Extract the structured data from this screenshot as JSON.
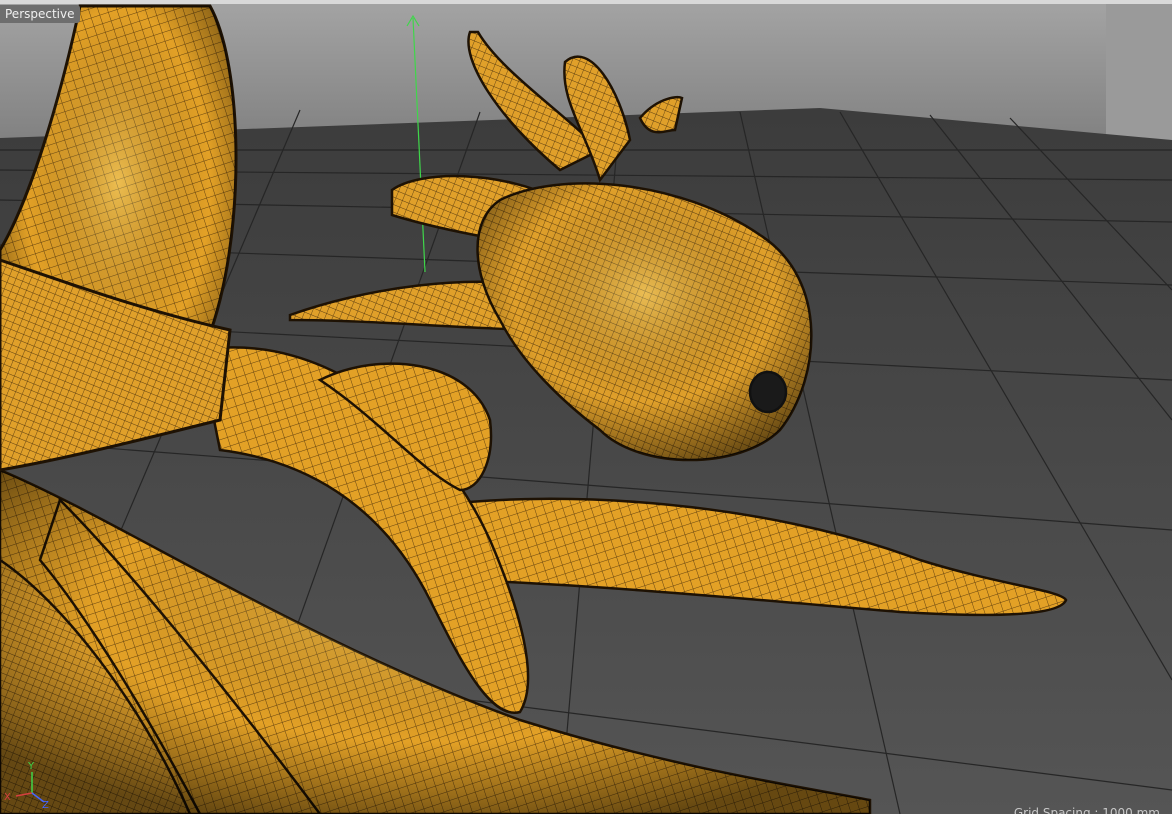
{
  "viewport": {
    "camera_label": "Perspective",
    "grid_spacing_text": "Grid Spacing : 1000 mm"
  },
  "axis_gizmo": {
    "x_label": "X",
    "y_label": "Y",
    "z_label": "Z",
    "x_color": "#d64040",
    "y_color": "#3fd64a",
    "z_color": "#4466ff"
  },
  "scene": {
    "model": "creature-octopus",
    "shading": "gouraud-with-wireframe",
    "surface_color": "#e3a126",
    "wire_color": "#3a2408",
    "floor_color": "#4a4a4a",
    "backdrop_color": "#8c8c8c",
    "y_axis_color": "#3fd64a"
  }
}
